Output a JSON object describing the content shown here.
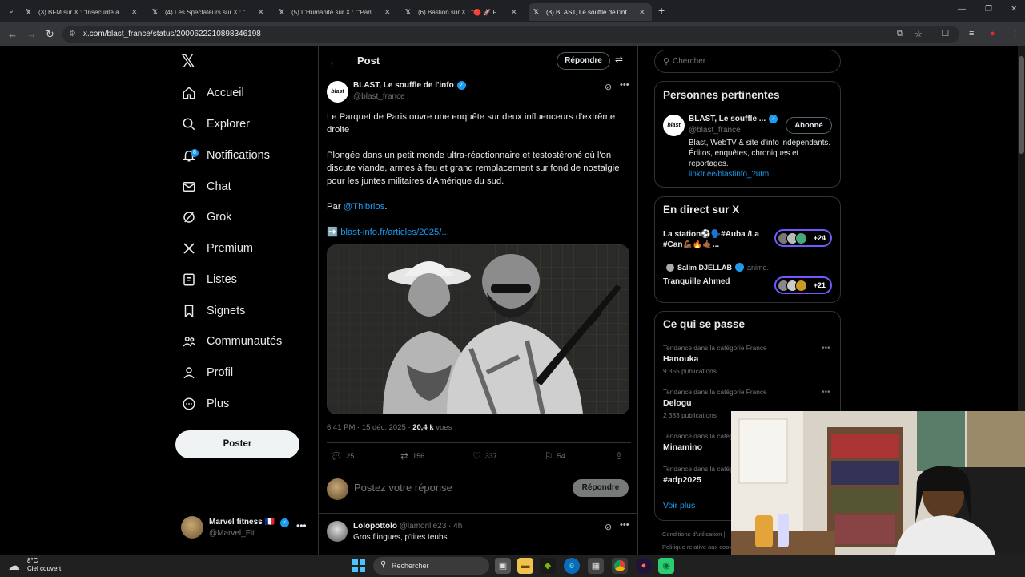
{
  "browser": {
    "tabs": [
      {
        "title": "(3) BFM sur X : \"Insécurité à Ma"
      },
      {
        "title": "(4) Les Spectateurs sur X : \"🔴 l"
      },
      {
        "title": "(5) L'Humanité sur X : \"\"Parler d"
      },
      {
        "title": "(6) Bastion sur X : \"🔴 🚀 FR ALE"
      },
      {
        "title": "(8) BLAST, Le souffle de l'info su"
      }
    ],
    "url": "x.com/blast_france/status/2000622210898346198"
  },
  "nav": {
    "items": [
      {
        "label": "Accueil",
        "icon": "home-icon"
      },
      {
        "label": "Explorer",
        "icon": "search-icon"
      },
      {
        "label": "Notifications",
        "icon": "bell-icon"
      },
      {
        "label": "Chat",
        "icon": "mail-icon"
      },
      {
        "label": "Grok",
        "icon": "grok-icon"
      },
      {
        "label": "Premium",
        "icon": "x-icon"
      },
      {
        "label": "Listes",
        "icon": "list-icon"
      },
      {
        "label": "Signets",
        "icon": "bookmark-icon"
      },
      {
        "label": "Communautés",
        "icon": "communities-icon"
      },
      {
        "label": "Profil",
        "icon": "profile-icon"
      },
      {
        "label": "Plus",
        "icon": "more-icon"
      }
    ],
    "notifications_badge": "8",
    "post_button": "Poster",
    "account": {
      "name": "Marvel fitness 🇫🇷",
      "handle": "@Marvel_Fit"
    }
  },
  "main": {
    "header_title": "Post",
    "reply_button": "Répondre",
    "author": {
      "name": "BLAST, Le souffle de l'info",
      "handle": "@blast_france",
      "avatar_text": "blast"
    },
    "paragraphs": [
      "Le Parquet de Paris ouvre une enquête sur deux influenceurs d'extrême droite",
      "Plongée dans un petit monde ultra-réactionnaire et testostéroné où l'on discute viande, armes à feu et grand remplacement sur fond de nostalgie pour les juntes militaires d'Amérique du sud."
    ],
    "by_prefix": "Par ",
    "by_mention": "@Thibrios",
    "by_suffix": ".",
    "link_arrow": "➡️",
    "link_text": "blast-info.fr/articles/2025/...",
    "timestamp": "6:41 PM · 15 déc. 2025 · ",
    "views_count": "20,4 k",
    "views_label": " vues",
    "stats": {
      "replies": "25",
      "reposts": "156",
      "likes": "337",
      "bookmarks": "54"
    },
    "reply_placeholder": "Postez votre réponse",
    "reply_submit": "Répondre",
    "comment": {
      "name": "Lolopottolo",
      "handle": "@lamorille23 · 4h",
      "text": "Gros flingues, p'tites teubs."
    }
  },
  "right": {
    "search_placeholder": "Chercher",
    "relevant": {
      "title": "Personnes pertinentes",
      "name": "BLAST, Le souffle ...",
      "handle": "@blast_france",
      "follow": "Abonné",
      "bio": "Blast, WebTV & site d'info indépendants. Éditos, enquêtes, chroniques et reportages.",
      "bio_link": "linktr.ee/blastinfo_?utm..."
    },
    "live": {
      "title": "En direct sur X",
      "items": [
        {
          "title": "La station⚽🗣️#Auba /La #Can💪🏾🔥🤙🏾...",
          "count": "+24"
        },
        {
          "host": "Salim DJELLAB",
          "host_note": "anime.",
          "title": "Tranquille Ahmed",
          "count": "+21"
        }
      ]
    },
    "trends": {
      "title": "Ce qui se passe",
      "items": [
        {
          "category": "Tendance dans la catégorie France",
          "name": "Hanouka",
          "count": "9 355 publications"
        },
        {
          "category": "Tendance dans la catégorie France",
          "name": "Delogu",
          "count": "2 383 publications"
        },
        {
          "category": "Tendance dans la catégorie France",
          "name": "Minamino",
          "count": ""
        },
        {
          "category": "Tendance dans la catégorie France",
          "name": "#adp2025",
          "count": ""
        }
      ],
      "see_more": "Voir plus"
    },
    "footer": [
      "Conditions d'utilisation  |",
      "Politique relative aux cookies"
    ]
  },
  "taskbar": {
    "temp": "8°C",
    "weather": "Ciel couvert",
    "search_placeholder": "Rechercher"
  },
  "colors": {
    "accent": "#1d9bf0",
    "live_ring": "#7856ff",
    "background": "#000000"
  }
}
